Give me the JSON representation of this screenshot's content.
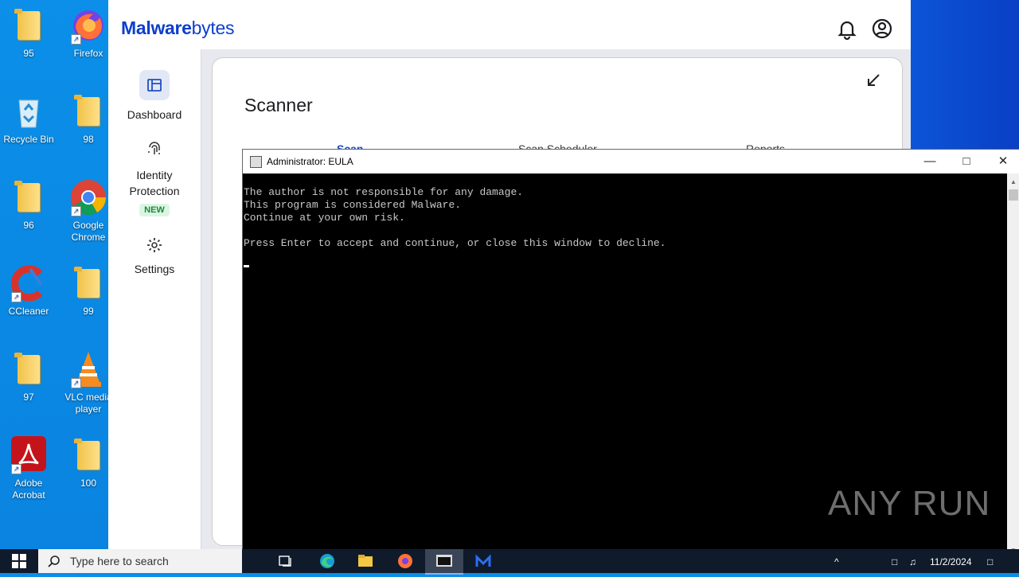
{
  "desktop": {
    "icons": [
      {
        "label": "95"
      },
      {
        "label": "Firefox"
      },
      {
        "label": "Recycle Bin"
      },
      {
        "label": "98"
      },
      {
        "label": "96"
      },
      {
        "label": "Google Chrome"
      },
      {
        "label": "CCleaner"
      },
      {
        "label": "99"
      },
      {
        "label": "97"
      },
      {
        "label": "VLC media player"
      },
      {
        "label": "Adobe Acrobat"
      },
      {
        "label": "100"
      }
    ]
  },
  "malwarebytes": {
    "logo_bold": "Malware",
    "logo_rest": "bytes",
    "nav": [
      {
        "label": "Dashboard",
        "icon": "dashboard-icon",
        "active": true
      },
      {
        "label": "Identity Protection",
        "badge": "NEW",
        "icon": "fingerprint-icon"
      },
      {
        "label": "Settings",
        "icon": "gear-icon"
      }
    ],
    "card_title": "Scanner",
    "tabs": [
      "Scan",
      "Scan Scheduler",
      "Reports"
    ],
    "accent": "#0d3ecc"
  },
  "console": {
    "title": "Administrator:  EULA",
    "lines": [
      "The author is not responsible for any damage.",
      "This program is considered Malware.",
      "Continue at your own risk.",
      "",
      "Press Enter to accept and continue, or close this window to decline."
    ]
  },
  "watermark": "ANY RUN",
  "taskbar": {
    "search_placeholder": "Type here to search",
    "date": "11/2/2024"
  }
}
